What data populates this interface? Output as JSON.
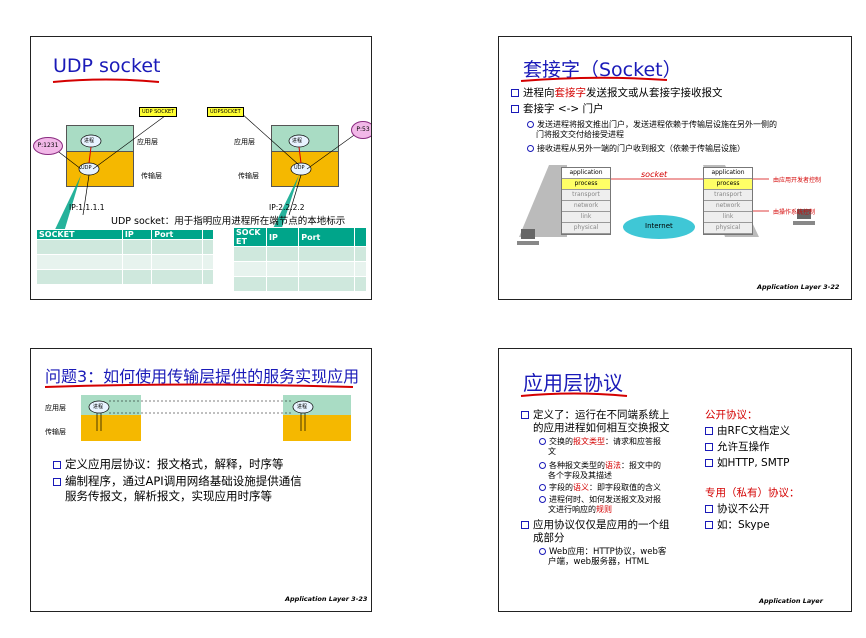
{
  "slide1": {
    "title": "UDP socket",
    "udp_socket_tag": "UDP SOCKET",
    "udpsocket_tag": "UDPSOCKET",
    "port_left": "P:1231",
    "port_right": "P:53",
    "process_label": "进程",
    "udp_label": "UDP",
    "app_layer": "应用层",
    "transport_layer": "传输层",
    "ip_left": "IP:1.1.1.1",
    "ip_right": "IP:2.2.2.2",
    "caption": "UDP socket：用于指明应用进程所在端节点的本地标示",
    "table_left_headers": [
      "SOCKET",
      "IP",
      "Port",
      ""
    ],
    "table_right_headers": [
      "SOCK ET",
      "IP",
      "Port",
      ""
    ]
  },
  "slide2": {
    "title": "套接字（Socket）",
    "b1_pre": "进程向",
    "b1_red": "套接字",
    "b1_post": "发送报文或从套接字接收报文",
    "b2": "套接字 <-> 门户",
    "s1a": "发送进程将报文推出门户，发送进程依赖于传输层设施在另外一侧的",
    "s1b": "门将报文交付给接受进程",
    "s2": "接收进程从另外一端的门户收到报文（依赖于传输层设施）",
    "stack_app": "application",
    "stack_process": "process",
    "stack_transport": "transport",
    "stack_network": "network",
    "stack_link": "link",
    "stack_physical": "physical",
    "socket_label": "socket",
    "internet_label": "Internet",
    "note1": "由应用开发者控制",
    "note2": "由操作系统控制",
    "footer": "Application Layer   3-22"
  },
  "slide3": {
    "title": "问题3：如何使用传输层提供的服务实现应用",
    "app_layer": "应用层",
    "transport_layer": "传输层",
    "process_label": "进程",
    "b1": "定义应用层协议：报文格式，解释，时序等",
    "b2a": "编制程序，通过API调用网络基础设施提供通信",
    "b2b": "服务传报文，解析报文，实现应用时序等",
    "footer": "Application Layer   3-23"
  },
  "slide4": {
    "title": "应用层协议",
    "b1a": "定义了：运行在不同端系统上",
    "b1b": "的应用进程如何相互交换报文",
    "s1_pre": "交换的",
    "s1_red": "报文类型",
    "s1_post": "：请求和应答报",
    "s1b": "文",
    "s2_pre": "各种报文类型的",
    "s2_red": "语法",
    "s2_post": "：报文中的",
    "s2b": "各个字段及其描述",
    "s3_pre": "字段的",
    "s3_red": "语义",
    "s3_post": "：即字段取值的含义",
    "s4a": "进程何时、如何发送报文及对报",
    "s4b_pre": "文进行响应的",
    "s4b_red": "规则",
    "b2a": "应用协议仅仅是应用的一个组",
    "b2b": "成部分",
    "s5a": "Web应用：HTTP协议，web客",
    "s5b": "户端，web服务器，HTML",
    "open_title": "公开协议：",
    "open1": "由RFC文档定义",
    "open2": "允许互操作",
    "open3": "如HTTP, SMTP",
    "prop_title": "专用（私有）协议：",
    "prop1": "协议不公开",
    "prop2": "如：Skype",
    "footer": "Application Layer"
  },
  "colors": {
    "title_blue": "#1a1ab8",
    "underline_red": "#d40000",
    "teal": "#00a58a",
    "app_green": "#a9dcc4",
    "transport_yellow": "#f5b800"
  }
}
